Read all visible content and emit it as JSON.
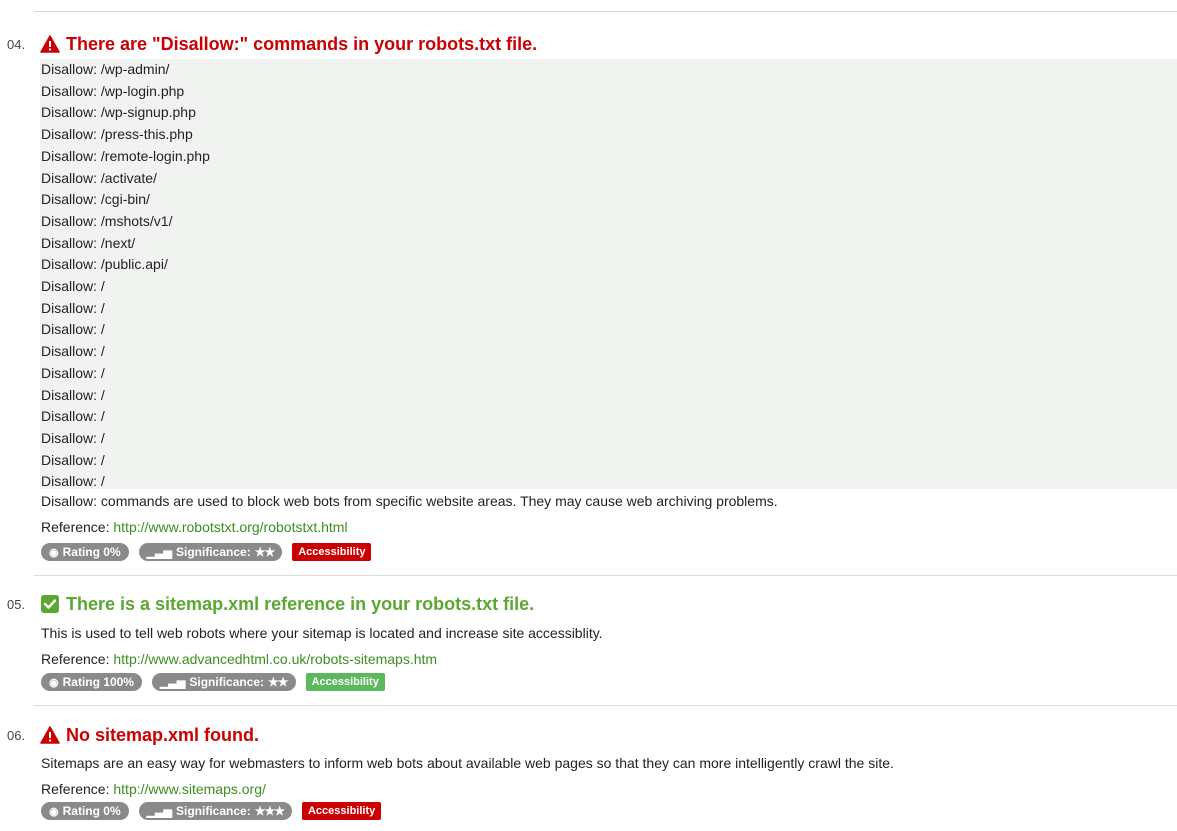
{
  "items": [
    {
      "number": "04.",
      "status": "error",
      "title": "There are \"Disallow:\" commands in your robots.txt file.",
      "code_lines": [
        "Disallow: /wp-admin/",
        "Disallow: /wp-login.php",
        "Disallow: /wp-signup.php",
        "Disallow: /press-this.php",
        "Disallow: /remote-login.php",
        "Disallow: /activate/",
        "Disallow: /cgi-bin/",
        "Disallow: /mshots/v1/",
        "Disallow: /next/",
        "Disallow: /public.api/",
        "Disallow: /",
        "Disallow: /",
        "Disallow: /",
        "Disallow: /",
        "Disallow: /",
        "Disallow: /",
        "Disallow: /",
        "Disallow: /",
        "Disallow: /",
        "Disallow: /"
      ],
      "description": "Disallow: commands are used to block web bots from specific website areas. They may cause web archiving problems.",
      "reference_label": "Reference: ",
      "reference_url": "http://www.robotstxt.org/robotstxt.html",
      "rating": "Rating 0%",
      "significance_label": "Significance:",
      "significance_stars": "★★",
      "category": "Accessibility",
      "category_color": "#cc0000"
    },
    {
      "number": "05.",
      "status": "ok",
      "title": "There is a sitemap.xml reference in your robots.txt file.",
      "description": "This is used to tell web robots where your sitemap is located and increase site accessiblity.",
      "reference_label": "Reference: ",
      "reference_url": "http://www.advancedhtml.co.uk/robots-sitemaps.htm",
      "rating": "Rating 100%",
      "significance_label": "Significance:",
      "significance_stars": "★★",
      "category": "Accessibility",
      "category_color": "#5cb85c"
    },
    {
      "number": "06.",
      "status": "error",
      "title": "No sitemap.xml found.",
      "description": "Sitemaps are an easy way for webmasters to inform web bots about available web pages so that they can more intelligently crawl the site.",
      "reference_label": "Reference: ",
      "reference_url": "http://www.sitemaps.org/",
      "rating": "Rating 0%",
      "significance_label": "Significance:",
      "significance_stars": "★★★",
      "category": "Accessibility",
      "category_color": "#cc0000"
    }
  ],
  "icons": {
    "warning": "warning-triangle-icon",
    "check": "check-square-icon",
    "gauge": "gauge-icon",
    "signal": "signal-bars-icon"
  },
  "colors": {
    "error": "#cc0000",
    "ok": "#5aa832",
    "link": "#3a8f1e",
    "badge_gray": "#8a8a8a",
    "code_bg": "#f1f3f1"
  }
}
